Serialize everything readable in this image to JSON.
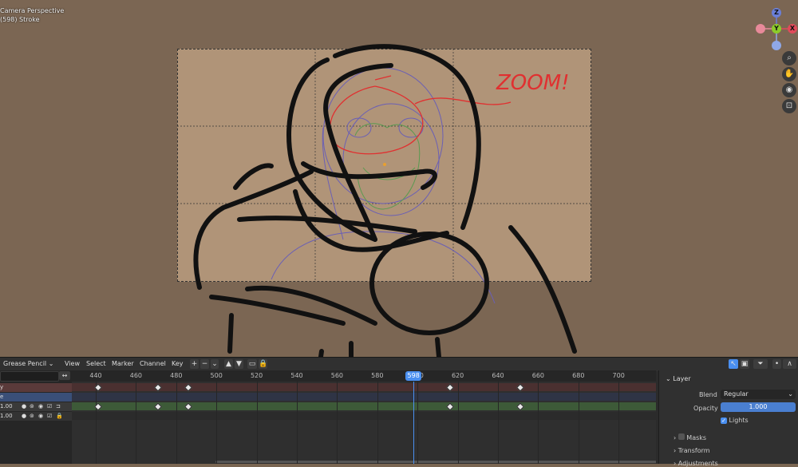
{
  "viewport": {
    "info_line1": "Camera Perspective",
    "info_line2": "(598) Stroke",
    "annotation": "ZOOM!",
    "gizmo": {
      "z": "Z",
      "y": "Y",
      "x": "X"
    },
    "tools": [
      "zoom-icon",
      "hand-icon",
      "camera-icon",
      "lock-icon"
    ]
  },
  "dopesheet": {
    "editor_type": "Grease Pencil",
    "menu": [
      "View",
      "Select",
      "Marker",
      "Channel",
      "Key"
    ],
    "ticks": [
      440,
      460,
      480,
      500,
      520,
      540,
      560,
      580,
      600,
      620,
      640,
      660,
      680,
      700
    ],
    "current_frame": "598",
    "channels": [
      {
        "label": "y",
        "value": ""
      },
      {
        "label": "e",
        "value": ""
      },
      {
        "label": "",
        "value": "1.00"
      },
      {
        "label": "",
        "value": "1.00"
      }
    ],
    "keyframes_row1": [
      441,
      471,
      486,
      616,
      651
    ],
    "keyframes_row2": [
      441,
      471,
      486,
      616,
      651
    ]
  },
  "properties": {
    "section": "Layer",
    "blend_label": "Blend",
    "blend_value": "Regular",
    "opacity_label": "Opacity",
    "opacity_value": "1.000",
    "lights_label": "Lights",
    "masks_label": "Masks",
    "transform_label": "Transform",
    "adjustments_label": "Adjustments"
  },
  "colors": {
    "accent": "#4a8ff0",
    "stroke": "#111111",
    "annotation": "#e03030",
    "sketch": "#7060b0",
    "sketch_green": "#5a9a50"
  }
}
